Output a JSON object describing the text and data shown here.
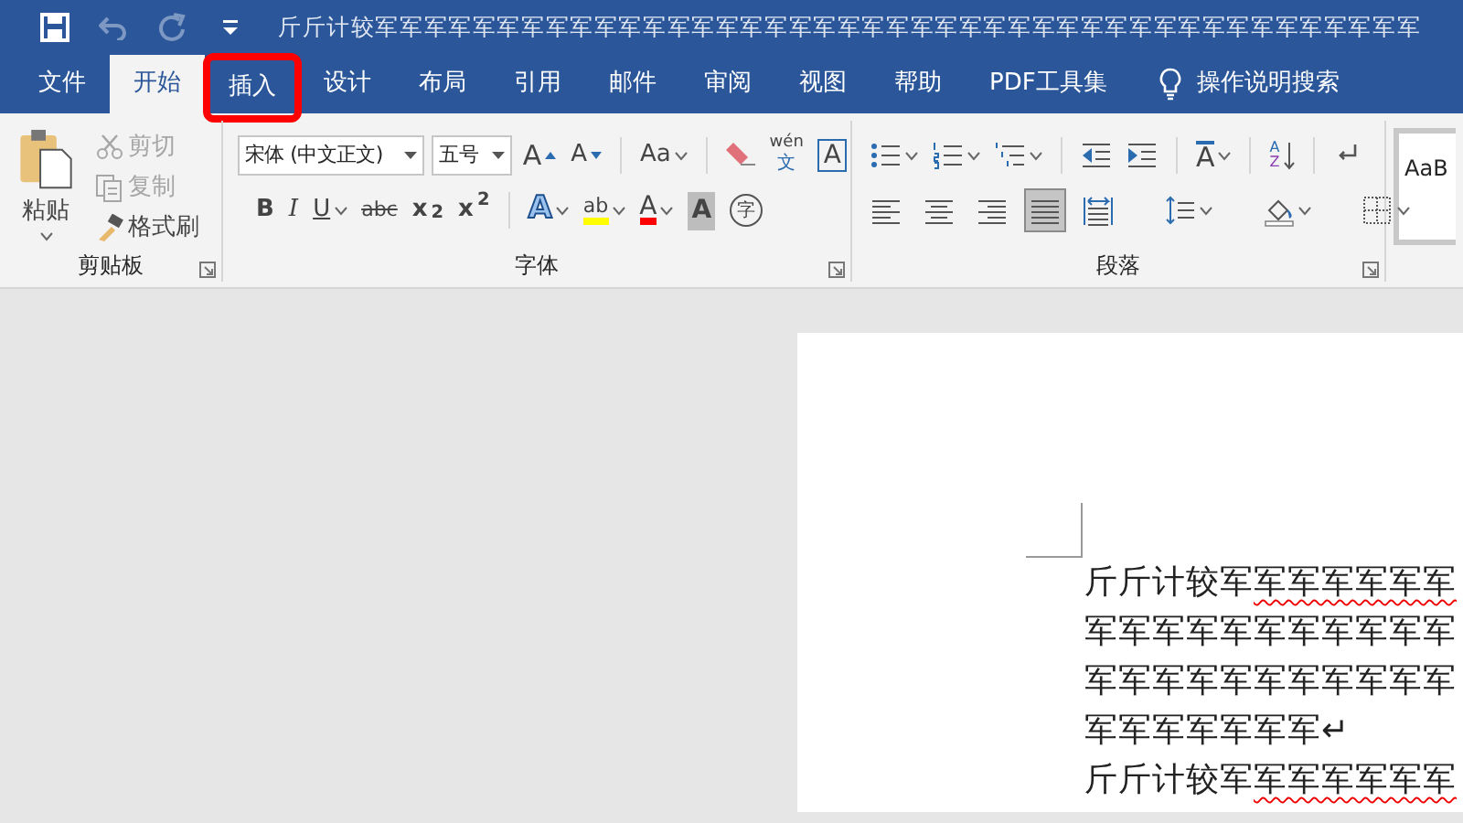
{
  "title_bar": {
    "quick_access": [
      {
        "kind": "save",
        "disabled": false
      },
      {
        "kind": "undo",
        "disabled": true
      },
      {
        "kind": "redo",
        "disabled": true
      },
      {
        "kind": "customize",
        "disabled": false
      }
    ],
    "title": "斤斤计较军军军军军军军军军军军军军军军军军军军军军军军军军军军军军军军军军军军军军军军军军军军"
  },
  "tabs": [
    {
      "label": "文件",
      "selected": false,
      "highlighted": false
    },
    {
      "label": "开始",
      "selected": true,
      "highlighted": false
    },
    {
      "label": "插入",
      "selected": false,
      "highlighted": true
    },
    {
      "label": "设计",
      "selected": false,
      "highlighted": false
    },
    {
      "label": "布局",
      "selected": false,
      "highlighted": false
    },
    {
      "label": "引用",
      "selected": false,
      "highlighted": false
    },
    {
      "label": "邮件",
      "selected": false,
      "highlighted": false
    },
    {
      "label": "审阅",
      "selected": false,
      "highlighted": false
    },
    {
      "label": "视图",
      "selected": false,
      "highlighted": false
    },
    {
      "label": "帮助",
      "selected": false,
      "highlighted": false
    },
    {
      "label": "PDF工具集",
      "selected": false,
      "highlighted": false
    }
  ],
  "tell_me": {
    "label": "操作说明搜索"
  },
  "clipboard": {
    "paste": "粘贴",
    "items": [
      {
        "kind": "cut",
        "label": "剪切",
        "disabled": true
      },
      {
        "kind": "copy",
        "label": "复制",
        "disabled": true
      },
      {
        "kind": "painter",
        "label": "格式刷",
        "disabled": false
      }
    ],
    "group_label": "剪贴板"
  },
  "font": {
    "font_name": "宋体 (中文正文)",
    "font_size": "五号",
    "row1": [
      {
        "kind": "grow",
        "label": "A",
        "dropdown": false
      },
      {
        "kind": "shrink",
        "label": "A",
        "dropdown": false
      },
      {
        "kind": "case",
        "label": "Aa",
        "dropdown": true
      },
      {
        "kind": "clear",
        "dropdown": false
      },
      {
        "kind": "phonetic",
        "label": "wén",
        "sub": "文",
        "dropdown": false
      },
      {
        "kind": "border",
        "label": "A",
        "dropdown": false
      }
    ],
    "row2": [
      {
        "kind": "bold",
        "label": "B",
        "dropdown": false
      },
      {
        "kind": "italic",
        "label": "I",
        "dropdown": false
      },
      {
        "kind": "underline",
        "label": "U",
        "dropdown": true
      },
      {
        "kind": "strike",
        "label": "abc",
        "dropdown": false
      },
      {
        "kind": "script",
        "label": "x$_{2}$",
        "dropdown": false
      },
      {
        "kind": "script",
        "label": "x$^{2}$",
        "dropdown": false
      },
      {
        "kind": "effect",
        "label": "A",
        "dropdown": true
      },
      {
        "kind": "highlight",
        "label": "ab",
        "color": "#ffff00",
        "dropdown": true
      },
      {
        "kind": "color",
        "label": "A",
        "color": "#ff0000",
        "dropdown": true
      },
      {
        "kind": "shading",
        "label": "A",
        "dropdown": false
      },
      {
        "kind": "enclose",
        "label": "字",
        "dropdown": false
      }
    ],
    "group_label": "字体"
  },
  "paragraph": {
    "row1": [
      {
        "kind": "bullets",
        "dropdown": true
      },
      {
        "kind": "numbering",
        "dropdown": true
      },
      {
        "kind": "multilevel",
        "dropdown": true
      },
      {
        "kind": "outdent",
        "dropdown": false
      },
      {
        "kind": "indent",
        "dropdown": false
      },
      {
        "kind": "asian",
        "label": "A",
        "dropdown": true
      },
      {
        "kind": "sort",
        "label": "A",
        "sub": "Z",
        "dropdown": false
      },
      {
        "kind": "marks",
        "dropdown": false
      }
    ],
    "alignment": [
      {
        "kind": "left",
        "selected": false
      },
      {
        "kind": "center",
        "selected": false
      },
      {
        "kind": "right",
        "selected": false
      },
      {
        "kind": "justify",
        "selected": true
      },
      {
        "kind": "distribute",
        "selected": false
      }
    ],
    "row2": [
      {
        "kind": "spacing",
        "dropdown": true
      },
      {
        "kind": "fill",
        "dropdown": true
      },
      {
        "kind": "borders",
        "dropdown": true
      }
    ],
    "group_label": "段落"
  },
  "styles": {
    "preview": "AaB"
  },
  "document": {
    "lines": [
      [
        {
          "text": "斤斤计较军",
          "misspelled": false
        },
        {
          "text": "军军军军军军",
          "misspelled": true
        }
      ],
      [
        {
          "text": "军军军军军军军军军军军",
          "misspelled": false
        }
      ],
      [
        {
          "text": "军军军军军军军军军军军",
          "misspelled": false
        }
      ],
      [
        {
          "text": "军军军军军军军↵",
          "misspelled": false
        }
      ],
      [
        {
          "text": "斤斤计较军",
          "misspelled": false
        },
        {
          "text": "军军军军军军",
          "misspelled": true
        }
      ]
    ]
  }
}
